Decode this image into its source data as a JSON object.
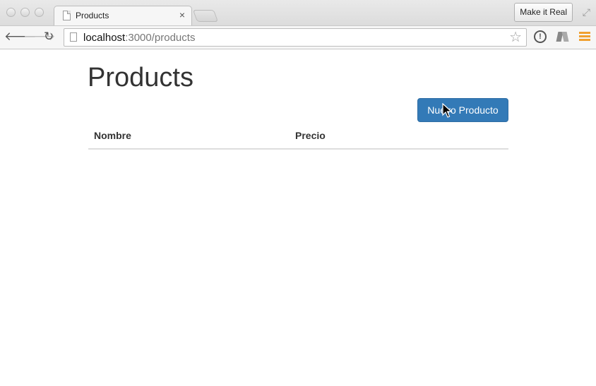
{
  "browser": {
    "tab": {
      "title": "Products",
      "close_glyph": "×"
    },
    "extension_button": "Make it Real",
    "address": {
      "host": "localhost",
      "rest": ":3000/products"
    }
  },
  "page": {
    "title": "Products",
    "new_button_label": "Nuevo Producto",
    "table": {
      "columns": [
        "Nombre",
        "Precio"
      ],
      "rows": []
    }
  },
  "colors": {
    "primary_button": "#337ab7",
    "menu_accent": "#f0a030"
  },
  "icons": [
    "page-icon",
    "close-icon",
    "back-arrow-icon",
    "forward-arrow-icon",
    "reload-icon",
    "star-icon",
    "info-icon",
    "book-icon",
    "hamburger-menu-icon",
    "fullscreen-icon",
    "mouse-cursor-icon"
  ]
}
